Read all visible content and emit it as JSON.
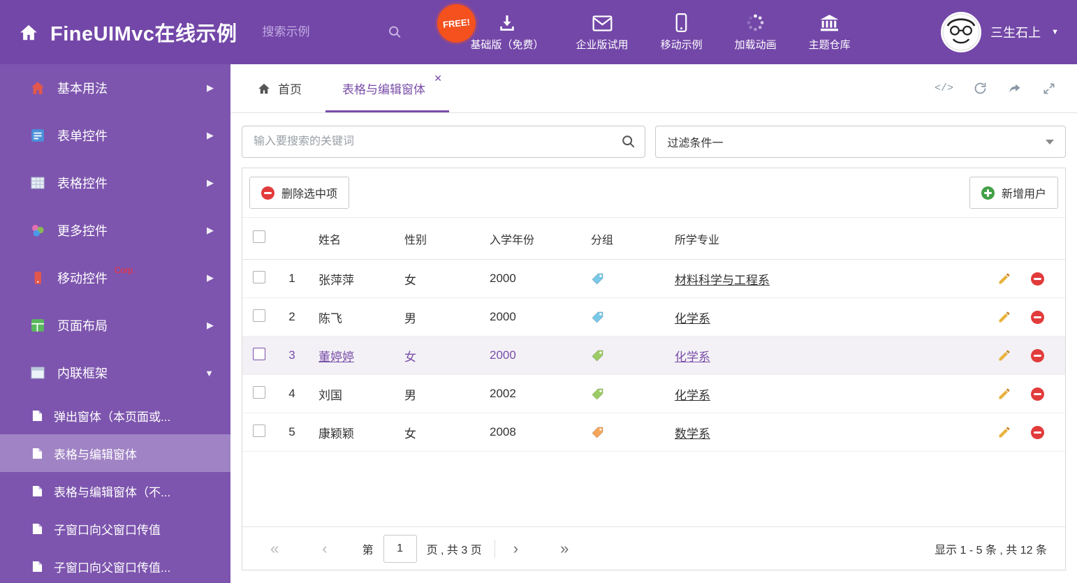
{
  "colors": {
    "accent": "#7a4ea8",
    "header_bg": "#7347a8",
    "sidebar_bg": "#7d55ae"
  },
  "header": {
    "title": "FineUIMvc在线示例",
    "search_placeholder": "搜索示例",
    "free_badge": "FREE!",
    "nav": [
      {
        "label": "基础版（免费）",
        "icon": "download-icon"
      },
      {
        "label": "企业版试用",
        "icon": "envelope-icon"
      },
      {
        "label": "移动示例",
        "icon": "mobile-icon"
      },
      {
        "label": "加载动画",
        "icon": "loading-icon"
      },
      {
        "label": "主题仓库",
        "icon": "bank-icon"
      }
    ],
    "user_name": "三生石上"
  },
  "sidebar": {
    "items": [
      {
        "label": "基本用法",
        "icon": "home-icon"
      },
      {
        "label": "表单控件",
        "icon": "form-icon"
      },
      {
        "label": "表格控件",
        "icon": "table-icon"
      },
      {
        "label": "更多控件",
        "icon": "widgets-icon"
      },
      {
        "label": "移动控件",
        "icon": "mobile-icon",
        "badge": "Corp."
      },
      {
        "label": "页面布局",
        "icon": "layout-icon"
      },
      {
        "label": "内联框架",
        "icon": "frame-icon",
        "expanded": true
      }
    ],
    "subitems": [
      {
        "label": "弹出窗体（本页面或...",
        "active": false
      },
      {
        "label": "表格与编辑窗体",
        "active": true
      },
      {
        "label": "表格与编辑窗体（不...",
        "active": false
      },
      {
        "label": "子窗口向父窗口传值",
        "active": false
      },
      {
        "label": "子窗口向父窗口传值...",
        "active": false
      }
    ]
  },
  "tabs": {
    "home": "首页",
    "active": "表格与编辑窗体"
  },
  "filters": {
    "search_placeholder": "输入要搜索的关键词",
    "dropdown_value": "过滤条件一"
  },
  "toolbar": {
    "delete_label": "删除选中项",
    "add_label": "新增用户"
  },
  "table": {
    "columns": [
      "姓名",
      "性别",
      "入学年份",
      "分组",
      "所学专业"
    ],
    "rows": [
      {
        "num": "1",
        "name": "张萍萍",
        "gender": "女",
        "year": "2000",
        "tag_color": "#79c8e8",
        "major": "材料科学与工程系",
        "selected": false
      },
      {
        "num": "2",
        "name": "陈飞",
        "gender": "男",
        "year": "2000",
        "tag_color": "#79c8e8",
        "major": "化学系",
        "selected": false
      },
      {
        "num": "3",
        "name": "董婷婷",
        "gender": "女",
        "year": "2000",
        "tag_color": "#9ccc65",
        "major": "化学系",
        "selected": true
      },
      {
        "num": "4",
        "name": "刘国",
        "gender": "男",
        "year": "2002",
        "tag_color": "#9ccc65",
        "major": "化学系",
        "selected": false
      },
      {
        "num": "5",
        "name": "康颖颖",
        "gender": "女",
        "year": "2008",
        "tag_color": "#f5a55a",
        "major": "数学系",
        "selected": false
      }
    ]
  },
  "pagination": {
    "prefix": "第",
    "current_page": "1",
    "suffix": "页 , 共 3 页",
    "summary": "显示 1 - 5 条 , 共 12 条"
  }
}
